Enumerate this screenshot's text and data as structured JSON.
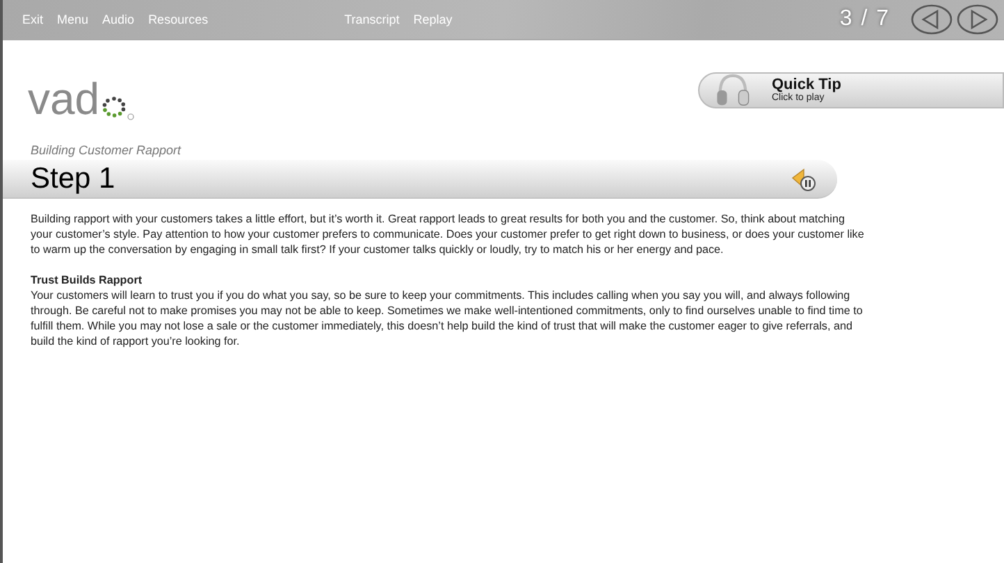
{
  "toolbar": {
    "menu": [
      "Exit",
      "Menu",
      "Audio",
      "Resources"
    ],
    "media": [
      "Transcript",
      "Replay"
    ],
    "page_counter": "3 / 7"
  },
  "logo": {
    "text": "vad"
  },
  "quick_tip": {
    "title": "Quick Tip",
    "subtitle": "Click to play"
  },
  "lesson": {
    "subtitle": "Building Customer Rapport",
    "step_title": "Step 1"
  },
  "body": [
    {
      "kind": "paragraph",
      "text": "Building rapport with your customers takes a little effort, but it’s worth it. Great rapport leads to great results for both you and the customer. So, think about matching your customer’s style. Pay attention to how your customer prefers to communicate. Does your customer prefer to get right down to business, or does your customer like to warm up the conversation by engaging in small talk first? If your customer talks quickly or loudly, try to match his or her energy and pace."
    },
    {
      "kind": "heading",
      "text": "Trust Builds Rapport"
    },
    {
      "kind": "paragraph",
      "text": "Your customers will learn to trust you if you do what you say, so be sure to keep your commitments. This includes calling when you say you will, and always following through. Be careful not to make promises you may not be able to keep. Sometimes we make well-intentioned commitments, only to find ourselves unable to find time to fulfill them. While you may not lose a sale or the customer immediately, this doesn’t help build the kind of trust that will make the customer eager to give referrals, and build the kind of rapport you’re looking for."
    }
  ]
}
